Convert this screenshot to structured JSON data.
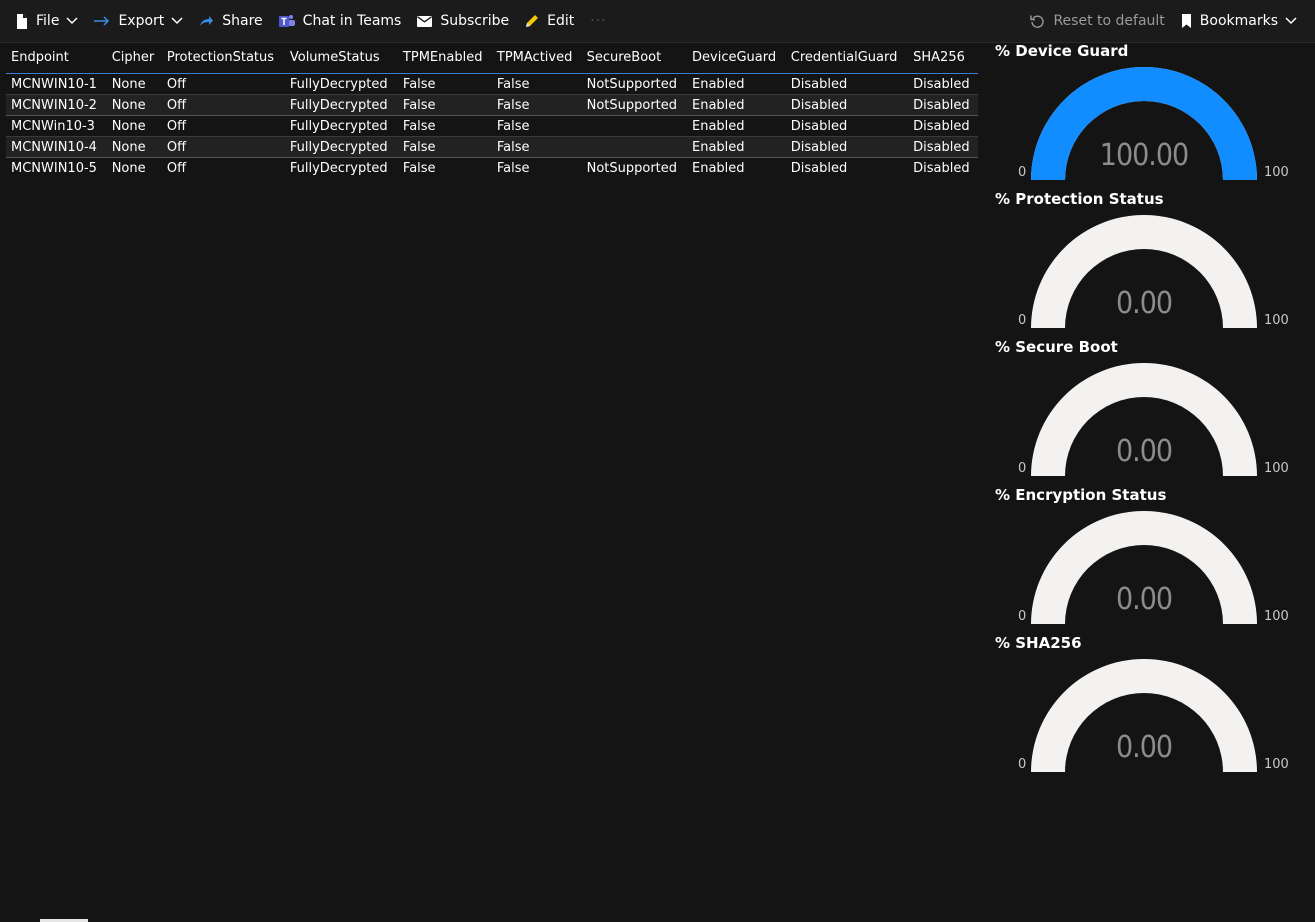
{
  "toolbar": {
    "file": "File",
    "export": "Export",
    "share": "Share",
    "chat_in_teams": "Chat in Teams",
    "subscribe": "Subscribe",
    "edit": "Edit",
    "more": "···",
    "reset_to_default": "Reset to default",
    "bookmarks": "Bookmarks"
  },
  "table": {
    "columns": [
      "Endpoint",
      "Cipher",
      "ProtectionStatus",
      "VolumeStatus",
      "TPMEnabled",
      "TPMActived",
      "SecureBoot",
      "DeviceGuard",
      "CredentialGuard",
      "SHA256"
    ],
    "rows": [
      [
        "MCNWIN10-1",
        "None",
        "Off",
        "FullyDecrypted",
        "False",
        "False",
        "NotSupported",
        "Enabled",
        "Disabled",
        "Disabled"
      ],
      [
        "MCNWIN10-2",
        "None",
        "Off",
        "FullyDecrypted",
        "False",
        "False",
        "NotSupported",
        "Enabled",
        "Disabled",
        "Disabled"
      ],
      [
        "MCNWin10-3",
        "None",
        "Off",
        "FullyDecrypted",
        "False",
        "False",
        "",
        "Enabled",
        "Disabled",
        "Disabled"
      ],
      [
        "MCNWIN10-4",
        "None",
        "Off",
        "FullyDecrypted",
        "False",
        "False",
        "",
        "Enabled",
        "Disabled",
        "Disabled"
      ],
      [
        "MCNWIN10-5",
        "None",
        "Off",
        "FullyDecrypted",
        "False",
        "False",
        "NotSupported",
        "Enabled",
        "Disabled",
        "Disabled"
      ]
    ]
  },
  "gauges": [
    {
      "title": "% Device Guard",
      "value": "100.00",
      "fraction": 1.0,
      "min": "0",
      "max": "100"
    },
    {
      "title": "% Protection Status",
      "value": "0.00",
      "fraction": 0.0,
      "min": "0",
      "max": "100"
    },
    {
      "title": "% Secure Boot",
      "value": "0.00",
      "fraction": 0.0,
      "min": "0",
      "max": "100"
    },
    {
      "title": "% Encryption Status",
      "value": "0.00",
      "fraction": 0.0,
      "min": "0",
      "max": "100"
    },
    {
      "title": "% SHA256",
      "value": "0.00",
      "fraction": 0.0,
      "min": "0",
      "max": "100"
    }
  ],
  "colors": {
    "gauge_fill": "#118dff",
    "gauge_track": "#f3f2f1",
    "accent": "#3a7fd4"
  }
}
